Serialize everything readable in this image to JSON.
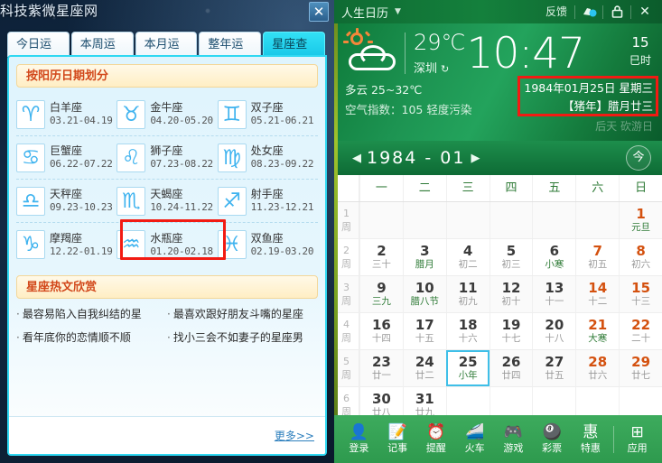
{
  "left_window": {
    "site_title": "科技紫微星座网",
    "close_label": "✕",
    "tabs": [
      {
        "label": "今日运势",
        "active": false
      },
      {
        "label": "本周运势",
        "active": false
      },
      {
        "label": "本月运势",
        "active": false
      },
      {
        "label": "整年运势",
        "active": false
      },
      {
        "label": "星座查询",
        "active": true
      }
    ],
    "section_title": "按阳历日期划分",
    "zodiacs": [
      {
        "glyph": "♈",
        "name": "白羊座",
        "date": "03.21-04.19"
      },
      {
        "glyph": "♉",
        "name": "金牛座",
        "date": "04.20-05.20"
      },
      {
        "glyph": "♊",
        "name": "双子座",
        "date": "05.21-06.21"
      },
      {
        "glyph": "♋",
        "name": "巨蟹座",
        "date": "06.22-07.22"
      },
      {
        "glyph": "♌",
        "name": "狮子座",
        "date": "07.23-08.22"
      },
      {
        "glyph": "♍",
        "name": "处女座",
        "date": "08.23-09.22"
      },
      {
        "glyph": "♎",
        "name": "天秤座",
        "date": "09.23-10.23"
      },
      {
        "glyph": "♏",
        "name": "天蝎座",
        "date": "10.24-11.22"
      },
      {
        "glyph": "♐",
        "name": "射手座",
        "date": "11.23-12.21"
      },
      {
        "glyph": "♑",
        "name": "摩羯座",
        "date": "12.22-01.19"
      },
      {
        "glyph": "♒",
        "name": "水瓶座",
        "date": "01.20-02.18"
      },
      {
        "glyph": "♓",
        "name": "双鱼座",
        "date": "02.19-03.20"
      }
    ],
    "hot_title": "星座热文欣赏",
    "hot_articles": [
      "最容易陷入自我纠结的星",
      "最喜欢跟好朋友斗嘴的星座",
      "看年底你的恋情顺不顺",
      "找小三会不如妻子的星座男"
    ],
    "more_label": "更多>>"
  },
  "calendar_window": {
    "title": "人生日历",
    "caret": "▼",
    "feedback_label": "反馈",
    "titlebar_icons": [
      "skin-icon",
      "lock-icon",
      "close-icon"
    ],
    "close_label": "✕",
    "weather": {
      "icon": "partly-cloudy-icon",
      "temperature": "29℃",
      "city": "深圳",
      "refresh_icon": "↻",
      "condition_line": "多云 25~32℃",
      "air_line": "空气指数：105 轻度污染"
    },
    "clock": {
      "time": "10:47",
      "hour_num": "15",
      "hour_name": "巳时"
    },
    "date_block": {
      "solar": "1984年01月25日  星期三",
      "lunar": "【猪年】腊月廿三",
      "faded": "后天  砍游日"
    },
    "month_nav": {
      "prev_icon": "◀",
      "next_icon": "▶",
      "label": "1984 - 01",
      "today_label": "今"
    },
    "weekday_headers": [
      "一",
      "二",
      "三",
      "四",
      "五",
      "六",
      "日"
    ],
    "week_numbers": [
      "1",
      "2",
      "3",
      "4",
      "5",
      "6"
    ],
    "week_unit": "周",
    "weeks": [
      [
        {
          "num": "",
          "sub": "",
          "empty": true
        },
        {
          "num": "",
          "sub": "",
          "empty": true
        },
        {
          "num": "",
          "sub": "",
          "empty": true
        },
        {
          "num": "",
          "sub": "",
          "empty": true
        },
        {
          "num": "",
          "sub": "",
          "empty": true
        },
        {
          "num": "",
          "sub": "",
          "empty": true
        },
        {
          "num": "1",
          "sub": "元旦",
          "weekend": true,
          "festival": true
        }
      ],
      [
        {
          "num": "2",
          "sub": "三十"
        },
        {
          "num": "3",
          "sub": "腊月",
          "festival": true
        },
        {
          "num": "4",
          "sub": "初二"
        },
        {
          "num": "5",
          "sub": "初三"
        },
        {
          "num": "6",
          "sub": "小寒",
          "festival": true
        },
        {
          "num": "7",
          "sub": "初五",
          "weekend": true
        },
        {
          "num": "8",
          "sub": "初六",
          "weekend": true
        }
      ],
      [
        {
          "num": "9",
          "sub": "三九",
          "festival": true
        },
        {
          "num": "10",
          "sub": "腊八节",
          "festival": true
        },
        {
          "num": "11",
          "sub": "初九"
        },
        {
          "num": "12",
          "sub": "初十"
        },
        {
          "num": "13",
          "sub": "十一"
        },
        {
          "num": "14",
          "sub": "十二",
          "weekend": true
        },
        {
          "num": "15",
          "sub": "十三",
          "weekend": true
        }
      ],
      [
        {
          "num": "16",
          "sub": "十四"
        },
        {
          "num": "17",
          "sub": "十五"
        },
        {
          "num": "18",
          "sub": "十六"
        },
        {
          "num": "19",
          "sub": "十七"
        },
        {
          "num": "20",
          "sub": "十八"
        },
        {
          "num": "21",
          "sub": "大寒",
          "weekend": true,
          "festival": true
        },
        {
          "num": "22",
          "sub": "二十",
          "weekend": true
        }
      ],
      [
        {
          "num": "23",
          "sub": "廿一"
        },
        {
          "num": "24",
          "sub": "廿二"
        },
        {
          "num": "25",
          "sub": "小年",
          "selected": true,
          "festival": true
        },
        {
          "num": "26",
          "sub": "廿四"
        },
        {
          "num": "27",
          "sub": "廿五"
        },
        {
          "num": "28",
          "sub": "廿六",
          "weekend": true
        },
        {
          "num": "29",
          "sub": "廿七",
          "weekend": true
        }
      ],
      [
        {
          "num": "30",
          "sub": "廿八"
        },
        {
          "num": "31",
          "sub": "廿九"
        },
        {
          "num": "",
          "sub": "",
          "empty": true
        },
        {
          "num": "",
          "sub": "",
          "empty": true
        },
        {
          "num": "",
          "sub": "",
          "empty": true
        },
        {
          "num": "",
          "sub": "",
          "empty": true
        },
        {
          "num": "",
          "sub": "",
          "empty": true
        }
      ]
    ],
    "dock": [
      {
        "glyph": "👤",
        "label": "登录",
        "icon": "user-icon"
      },
      {
        "glyph": "📝",
        "label": "记事",
        "icon": "note-icon"
      },
      {
        "glyph": "⏰",
        "label": "提醒",
        "icon": "alarm-icon"
      },
      {
        "glyph": "🚄",
        "label": "火车",
        "icon": "train-icon"
      },
      {
        "glyph": "🎮",
        "label": "游戏",
        "icon": "gamepad-icon"
      },
      {
        "glyph": "🎱",
        "label": "彩票",
        "icon": "lottery-icon"
      },
      {
        "glyph": "惠",
        "label": "特惠",
        "icon": "discount-icon"
      },
      {
        "glyph": "⊞",
        "label": "应用",
        "icon": "apps-icon"
      }
    ]
  },
  "colors": {
    "accent_cyan": "#2fd8f2",
    "accent_green": "#1d9452",
    "highlight_red": "#f21b13",
    "weekend_orange": "#d4510f",
    "festival_green": "#2f7b37",
    "section_orange": "#d2471a"
  }
}
